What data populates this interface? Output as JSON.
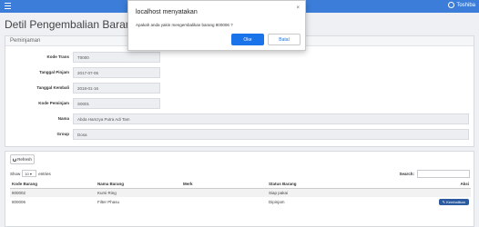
{
  "topbar": {
    "user_name": "Toshiba"
  },
  "page": {
    "title": "Detil Pengembalian Barang"
  },
  "panel": {
    "header": "Peminjaman",
    "fields": [
      {
        "label": "Kode Trans",
        "value": "T0000"
      },
      {
        "label": "Tanggal Pinjam",
        "value": "2017-07-05"
      },
      {
        "label": "Tanggal Kembali",
        "value": "2018-01-16"
      },
      {
        "label": "Kode Peminjam",
        "value": "S0001"
      },
      {
        "label": "Nama",
        "value": "Abda Hamzya Putra Adi Tam"
      },
      {
        "label": "Group",
        "value": "Dosa"
      }
    ]
  },
  "list": {
    "refresh_label": "Refresh",
    "show_label": "Show",
    "entries_value": "10",
    "entries_label": "entries",
    "search_label": "Search:",
    "columns": [
      "Kode Barang",
      "Nama Barang",
      "Merk",
      "Status Barang",
      "Aksi"
    ],
    "rows": [
      {
        "kode": "800002",
        "nama": "Kursi Ring",
        "merk": "",
        "status": "Siap pakai",
        "aksi": ""
      },
      {
        "kode": "800006",
        "nama": "Filter Phasu",
        "merk": "",
        "status": "Dipinjam",
        "aksi": "Kembalikan"
      }
    ]
  },
  "dialog": {
    "title": "localhost menyatakan",
    "close": "×",
    "message": "Apakah anda yakin mengembalikan barang 800006 ?",
    "ok_label": "Oke",
    "cancel_label": "Batal"
  },
  "colors": {
    "topbar": "#3b7dd8",
    "ok_button": "#1a73e8",
    "action_button": "#2c5aa0"
  }
}
